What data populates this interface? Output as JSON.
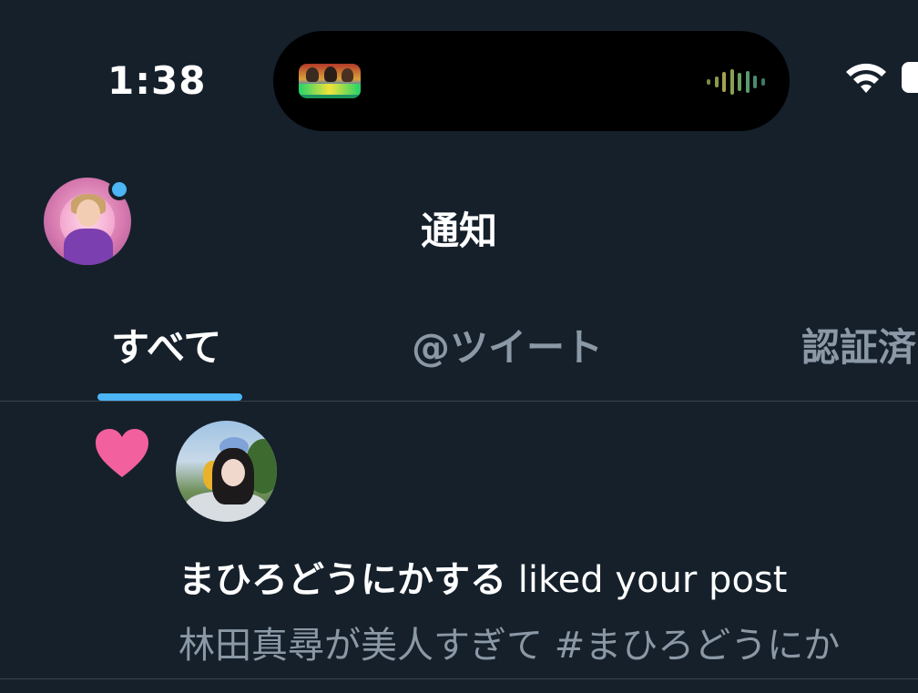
{
  "status_bar": {
    "time": "1:38"
  },
  "header": {
    "title": "通知"
  },
  "tabs": [
    {
      "label": "すべて",
      "selected": true
    },
    {
      "label": "@ツイート",
      "selected": false
    },
    {
      "label": "認証済",
      "selected": false
    }
  ],
  "notification": {
    "type_icon": "heart-icon",
    "user_name": "まひろどうにかする",
    "action_text": " liked your post",
    "post_preview": "林田真尋が美人すぎて #まひろどうにか"
  },
  "colors": {
    "background": "#15202b",
    "accent": "#4cb5f5",
    "like": "#f3609e",
    "secondary_text": "#8b98a5",
    "divider": "#38444d"
  }
}
